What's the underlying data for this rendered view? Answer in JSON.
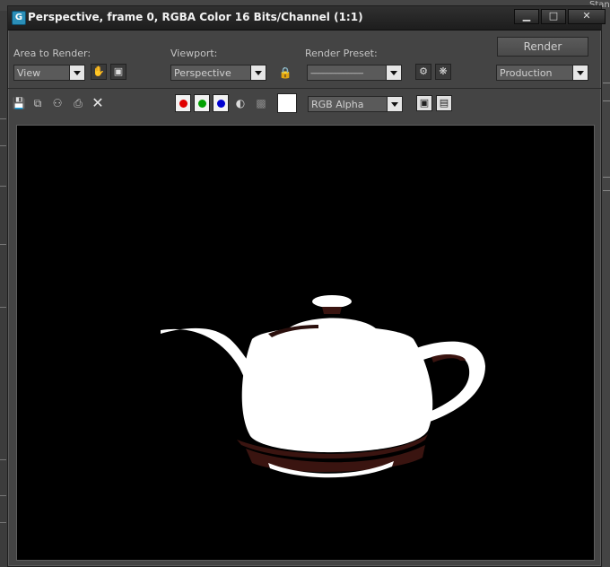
{
  "window": {
    "title": "Perspective, frame 0, RGBA Color 16 Bits/Channel (1:1)",
    "app_icon_letter": "G",
    "minimize_icon": "minimize-icon",
    "maximize_icon": "maximize-icon",
    "close_icon": "close-icon"
  },
  "background": {
    "top_right_text": "Stan"
  },
  "controls": {
    "area_label": "Area to Render:",
    "area_value": "View",
    "viewport_label": "Viewport:",
    "viewport_value": "Perspective",
    "preset_label": "Render Preset:",
    "preset_value": "--------------------------",
    "render_button": "Render",
    "production_value": "Production"
  },
  "toolbar": {
    "channel_value": "RGB Alpha",
    "colors": {
      "red": "#e00000",
      "green": "#00a000",
      "blue": "#0000d0"
    }
  },
  "accent": {
    "bg": "#444444",
    "titlebar": "#1d1d1d",
    "render_wall": "#000000"
  }
}
